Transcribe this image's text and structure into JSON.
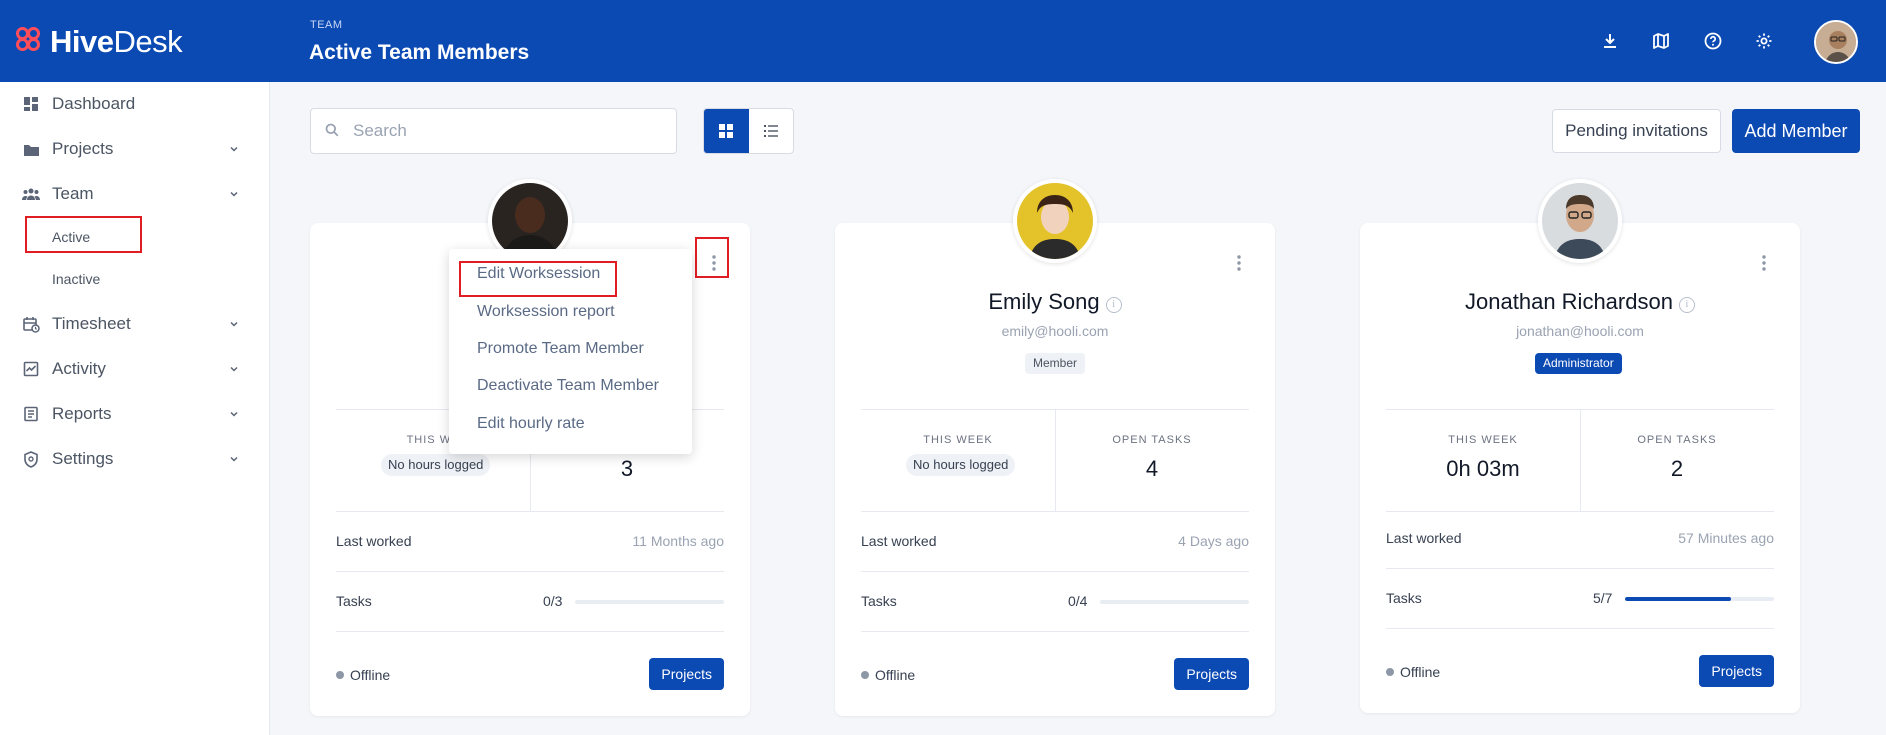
{
  "header": {
    "brand_bold": "Hive",
    "brand_light": "Desk",
    "section": "TEAM",
    "title": "Active Team Members",
    "icons": [
      "download-icon",
      "map-icon",
      "help-icon",
      "settings-icon"
    ]
  },
  "sidebar": {
    "items": [
      {
        "label": "Dashboard",
        "icon": "dashboard-icon",
        "has_chevron": false
      },
      {
        "label": "Projects",
        "icon": "folder-icon",
        "has_chevron": true
      },
      {
        "label": "Team",
        "icon": "team-icon",
        "has_chevron": true
      },
      {
        "label": "Timesheet",
        "icon": "timesheet-icon",
        "has_chevron": true
      },
      {
        "label": "Activity",
        "icon": "activity-icon",
        "has_chevron": true
      },
      {
        "label": "Reports",
        "icon": "reports-icon",
        "has_chevron": true
      },
      {
        "label": "Settings",
        "icon": "settings-shield-icon",
        "has_chevron": true
      }
    ],
    "team_sub": [
      "Active",
      "Inactive"
    ]
  },
  "toolbar": {
    "search_placeholder": "Search",
    "pending_label": "Pending invitations",
    "add_label": "Add Member"
  },
  "dropdown": {
    "items": [
      "Edit Worksession",
      "Worksession report",
      "Promote Team Member",
      "Deactivate Team Member",
      "Edit hourly rate"
    ]
  },
  "labels": {
    "this_week": "THIS WEEK",
    "this_week_partial": "THIS WE",
    "open_tasks": "OPEN TASKS",
    "last_worked": "Last worked",
    "tasks": "Tasks",
    "projects": "Projects"
  },
  "members": [
    {
      "name": "",
      "email": "",
      "role": "",
      "this_week": "No hours logged",
      "open_tasks": "3",
      "last_worked": "11 Months ago",
      "tasks": "0/3",
      "tasks_fraction": 0,
      "status": "Offline"
    },
    {
      "name": "Emily Song",
      "email": "emily@hooli.com",
      "role": "Member",
      "this_week": "No hours logged",
      "open_tasks": "4",
      "last_worked": "4 Days ago",
      "tasks": "0/4",
      "tasks_fraction": 0,
      "status": "Offline"
    },
    {
      "name": "Jonathan Richardson",
      "email": "jonathan@hooli.com",
      "role": "Administrator",
      "this_week": "0h 03m",
      "open_tasks": "2",
      "last_worked": "57 Minutes ago",
      "tasks": "5/7",
      "tasks_fraction": 0.71,
      "status": "Offline"
    }
  ],
  "colors": {
    "primary": "#0b49b3",
    "highlight": "#e11d24",
    "logo_accent": "#ff4d5a"
  }
}
